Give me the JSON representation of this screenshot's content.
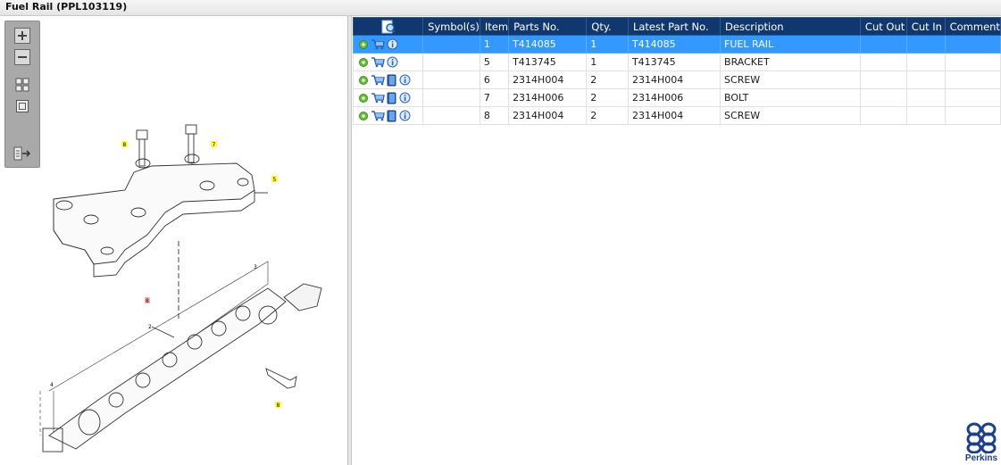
{
  "window": {
    "title": "Fuel Rail (PPL103119)"
  },
  "toolbar": {
    "zoom_in": "zoom-in",
    "zoom_out": "zoom-out",
    "fit": "fit-grid",
    "actual": "actual-size",
    "export": "export-list"
  },
  "drawing": {
    "callouts": [
      "8",
      "7",
      "5",
      "8",
      "3",
      "2",
      "4",
      "8"
    ]
  },
  "table": {
    "headers": [
      "",
      "Symbol(s)",
      "Item",
      "Parts No.",
      "Qty.",
      "Latest Part No.",
      "Description",
      "Cut Out",
      "Cut In",
      "Comment"
    ],
    "rows": [
      {
        "item": "1",
        "part_no": "T414085",
        "qty": "1",
        "latest": "T414085",
        "description": "FUEL RAIL",
        "selected": true,
        "has_book": false
      },
      {
        "item": "5",
        "part_no": "T413745",
        "qty": "1",
        "latest": "T413745",
        "description": "BRACKET",
        "selected": false,
        "has_book": false
      },
      {
        "item": "6",
        "part_no": "2314H004",
        "qty": "2",
        "latest": "2314H004",
        "description": "SCREW",
        "selected": false,
        "has_book": true
      },
      {
        "item": "7",
        "part_no": "2314H006",
        "qty": "2",
        "latest": "2314H006",
        "description": "BOLT",
        "selected": false,
        "has_book": true
      },
      {
        "item": "8",
        "part_no": "2314H004",
        "qty": "2",
        "latest": "2314H004",
        "description": "SCREW",
        "selected": false,
        "has_book": true
      }
    ]
  },
  "brand": {
    "name": "Perkins",
    "color": "#1c3f8e"
  },
  "colors": {
    "header": "#11386e",
    "selected": "#3399ff",
    "callout": "#ffff33"
  }
}
